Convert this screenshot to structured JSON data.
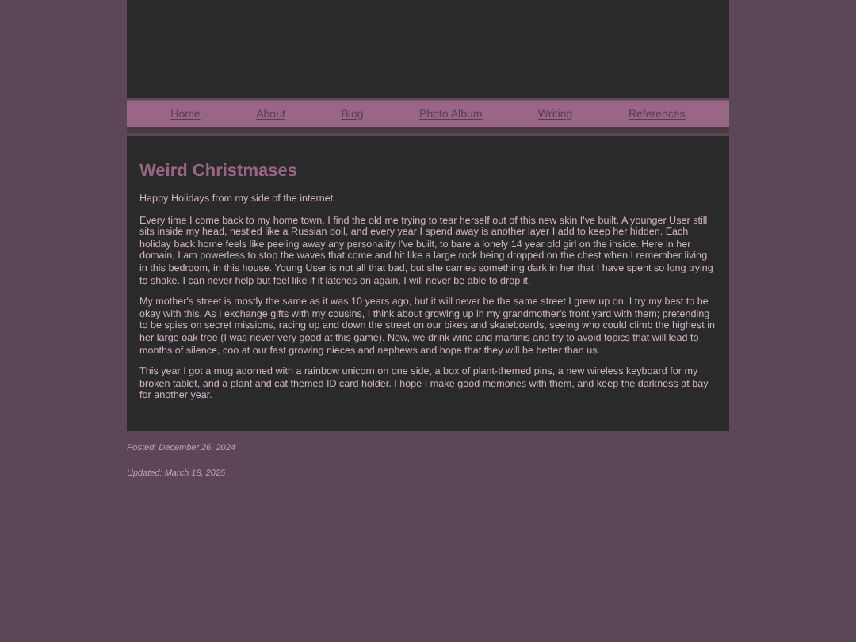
{
  "nav": [
    {
      "label": "Home"
    },
    {
      "label": "About"
    },
    {
      "label": "Blog"
    },
    {
      "label": "Photo Album"
    },
    {
      "label": "Writing"
    },
    {
      "label": "References"
    }
  ],
  "post": {
    "title": "Weird Christmases",
    "paragraphs": [
      "Happy Holidays from my side of the internet.",
      "Every time I come back to my home town, I find the old me trying to tear herself out of this new skin I've built. A younger User still sits inside my head, nestled like a Russian doll, and every year I spend away is another layer I add to keep her hidden. Each holiday back home feels like peeling away any personality I've built, to bare a lonely 14 year old girl on the inside. Here in her domain, I am powerless to stop the waves that come and hit like a large rock being dropped on the chest when I remember living in this bedroom, in this house. Young User is not all that bad, but she carries something dark in her that I have spent so long trying to shake. I can never help but feel like if it latches on again, I will never be able to drop it.",
      "My mother's street is mostly the same as it was 10 years ago, but it will never be the same street I grew up on. I try my best to be okay with this. As I exchange gifts with my cousins, I think about growing up in my grandmother's front yard with them; pretending to be spies on secret missions, racing up and down the street on our bikes and skateboards, seeing who could climb the highest in her large oak tree (I was never very good at this game). Now, we drink wine and martinis and try to avoid topics that will lead to months of silence, coo at our fast growing nieces and nephews and hope that they will be better than us.",
      "This year I got a mug adorned with a rainbow unicorn on one side, a box of plant-themed pins, a new wireless keyboard for my broken tablet, and a plant and cat themed ID card holder. I hope I make good memories with them, and keep the darkness at bay for another year."
    ]
  },
  "footer": [
    "Posted: December 26, 2024",
    "Updated: March 18, 2025"
  ]
}
